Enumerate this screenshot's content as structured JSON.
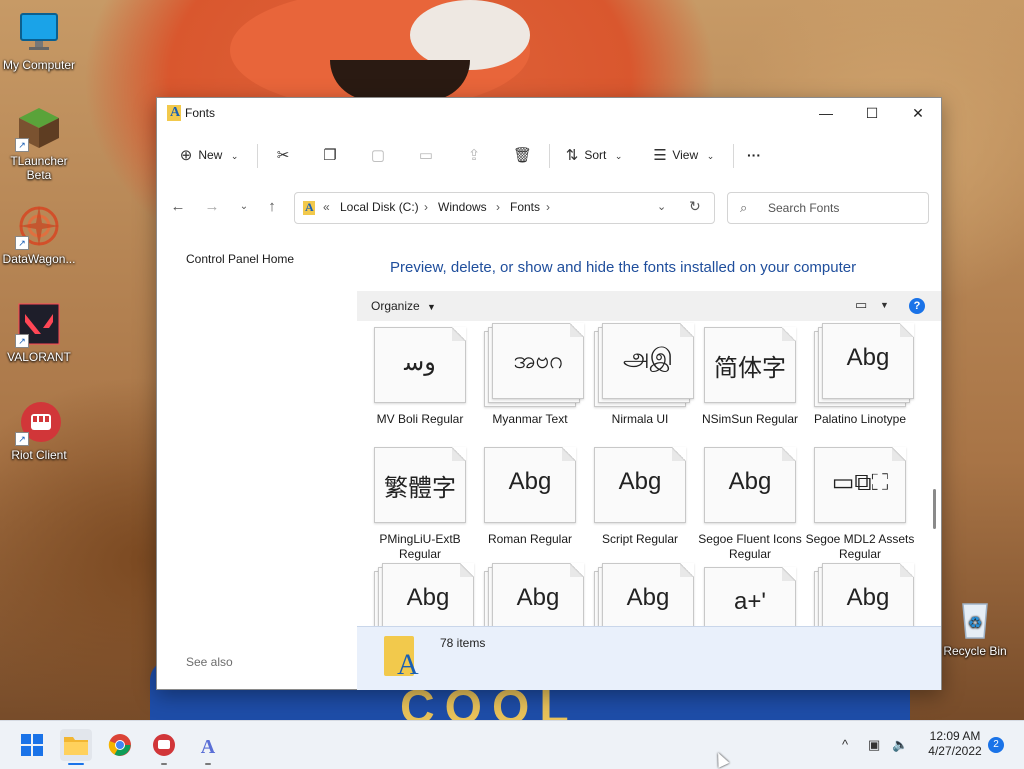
{
  "desktop": {
    "icons": [
      {
        "label": "My Computer"
      },
      {
        "label": "TLauncher Beta"
      },
      {
        "label": "DataWagon..."
      },
      {
        "label": "VALORANT"
      },
      {
        "label": "Riot Client"
      },
      {
        "label": "Recycle Bin"
      }
    ]
  },
  "window": {
    "title": "Fonts",
    "controls": {
      "minimize": "—",
      "maximize": "☐",
      "close": "✕"
    }
  },
  "commandbar": {
    "new_label": "New",
    "sort_label": "Sort",
    "view_label": "View",
    "more_label": "···"
  },
  "address": {
    "overflow": "«",
    "crumbs": [
      "Local Disk (C:)",
      "Windows",
      "Fonts"
    ]
  },
  "search": {
    "placeholder": "Search Fonts"
  },
  "leftpane": {
    "control_panel_home": "Control Panel Home",
    "see_also": "See also"
  },
  "main": {
    "heading": "Preview, delete, or show and hide the fonts installed on your computer",
    "organize_label": "Organize",
    "help": "?"
  },
  "fonts": [
    {
      "name": "MV Boli Regular",
      "glyph": "ﻭﺳ",
      "stacked": false
    },
    {
      "name": "Myanmar Text",
      "glyph": "အဗဂ",
      "stacked": true
    },
    {
      "name": "Nirmala UI",
      "glyph": "அஇ",
      "stacked": true
    },
    {
      "name": "NSimSun Regular",
      "glyph": "简体字",
      "stacked": false
    },
    {
      "name": "Palatino Linotype",
      "glyph": "Abg",
      "stacked": true
    },
    {
      "name": "PMingLiU-ExtB Regular",
      "glyph": "繁體字",
      "stacked": false
    },
    {
      "name": "Roman Regular",
      "glyph": "Abg",
      "stacked": false
    },
    {
      "name": "Script Regular",
      "glyph": "Abg",
      "stacked": false
    },
    {
      "name": "Segoe Fluent Icons Regular",
      "glyph": "Abg",
      "stacked": false
    },
    {
      "name": "Segoe MDL2 Assets Regular",
      "glyph": "▭⧉⛶",
      "stacked": false
    },
    {
      "name": "",
      "glyph": "Abg",
      "stacked": true
    },
    {
      "name": "",
      "glyph": "Abg",
      "stacked": true
    },
    {
      "name": "",
      "glyph": "Abg",
      "stacked": true
    },
    {
      "name": "",
      "glyph": "a+'",
      "stacked": false
    },
    {
      "name": "",
      "glyph": "Abg",
      "stacked": true
    }
  ],
  "details": {
    "count": "78 items"
  },
  "taskbar": {
    "clock_time": "12:09 AM",
    "clock_date": "4/27/2022",
    "notification_count": "2",
    "tray_chevron": "^"
  }
}
